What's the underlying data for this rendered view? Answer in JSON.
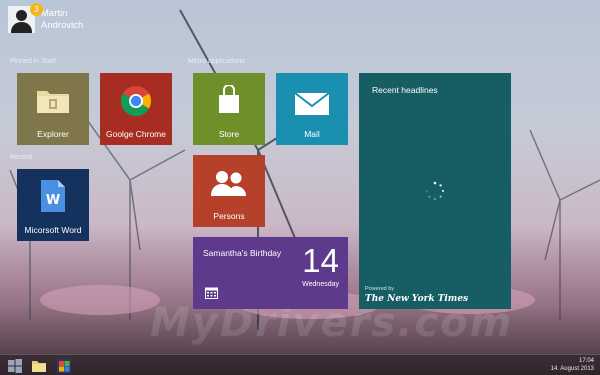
{
  "user": {
    "first_name": "Martin",
    "last_name": "Androvich",
    "notification_count": "3"
  },
  "sections": {
    "pinned": "Pinned in Start",
    "recent": "Recent",
    "metro": "Metro applications"
  },
  "tiles": {
    "explorer": "Explorer",
    "chrome": "Goolge Chrome",
    "word": "Micorsoft Word",
    "store": "Store",
    "mail": "Mail",
    "persons": "Persons"
  },
  "birthday": {
    "title": "Samantha's Birthday",
    "day": "14",
    "weekday": "Wednesday"
  },
  "news": {
    "title": "Recent headlines",
    "powered": "Powered by",
    "brand": "The New York Times"
  },
  "watermark": "MyDrivers.com",
  "clock": {
    "time": "17:04",
    "date": "14. August 2013"
  },
  "colors": {
    "explorer": "#7f7649",
    "chrome": "#a72c22",
    "word": "#15325e",
    "store": "#6f8f2a",
    "mail": "#1b8fb0",
    "persons": "#b5412a",
    "birthday": "#5e3a8c",
    "news": "#165d64",
    "badge": "#f2b51c"
  },
  "icons": [
    "windows-logo-icon",
    "folder-icon",
    "chrome-icon",
    "word-icon",
    "shopping-bag-icon",
    "mail-icon",
    "people-icon",
    "calendar-icon",
    "loading-spinner-icon",
    "control-panel-icon"
  ]
}
